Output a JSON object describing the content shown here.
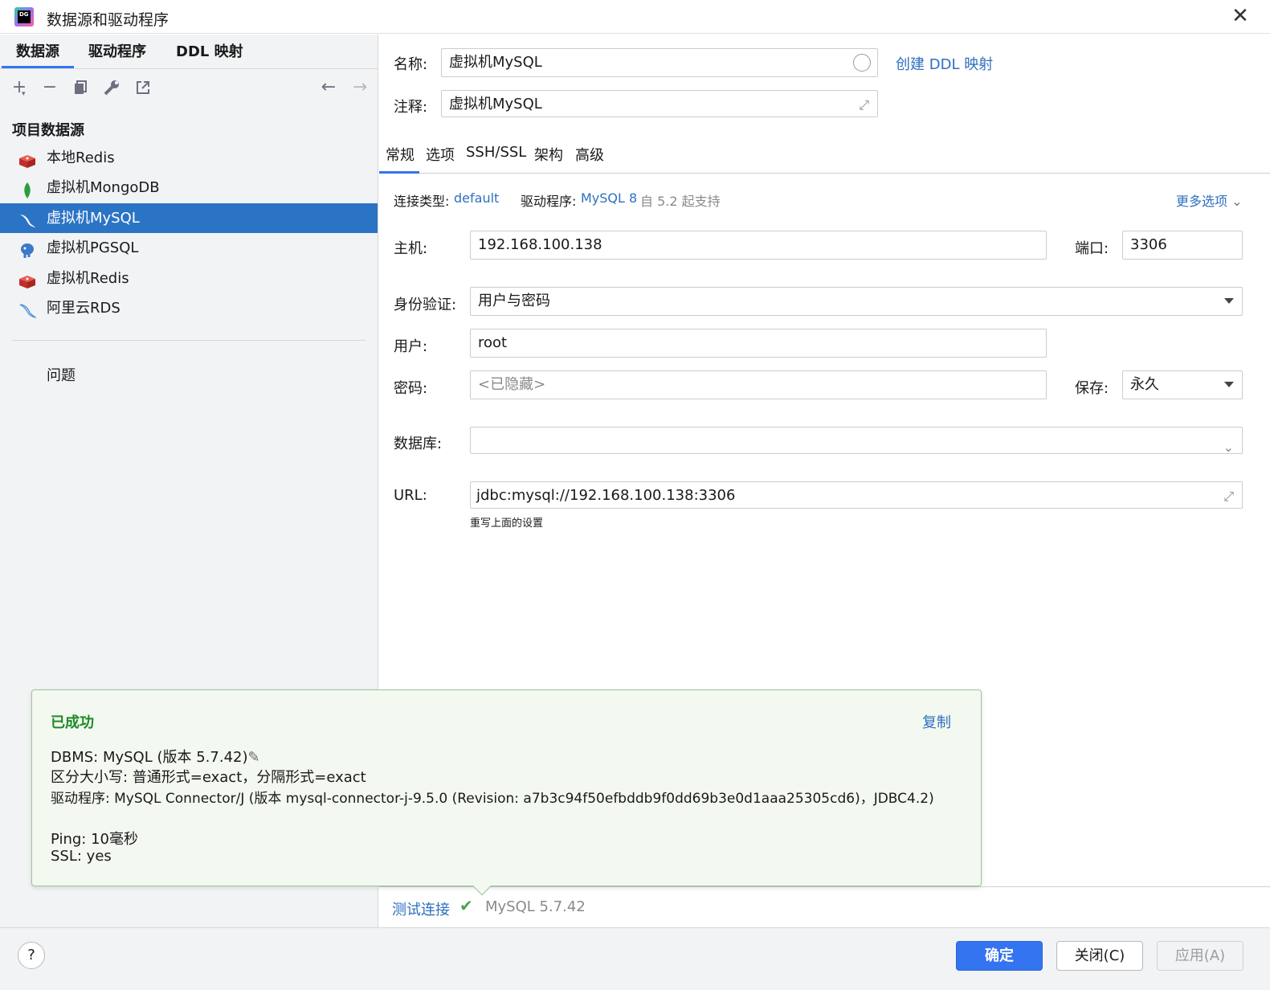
{
  "window": {
    "title": "数据源和驱动程序",
    "app_icon_text": "DG"
  },
  "left_tabs": [
    "数据源",
    "驱动程序",
    "DDL 映射"
  ],
  "section_title": "项目数据源",
  "datasources": [
    {
      "label": "本地Redis",
      "icon": "redis-icon",
      "selected": false
    },
    {
      "label": "虚拟机MongoDB",
      "icon": "mongodb-icon",
      "selected": false
    },
    {
      "label": "虚拟机MySQL",
      "icon": "mysql-icon",
      "selected": true
    },
    {
      "label": "虚拟机PGSQL",
      "icon": "postgresql-icon",
      "selected": false
    },
    {
      "label": "虚拟机Redis",
      "icon": "redis-icon",
      "selected": false
    },
    {
      "label": "阿里云RDS",
      "icon": "mysql-icon",
      "selected": false
    }
  ],
  "problems_label": "问题",
  "form": {
    "name_label": "名称:",
    "name_value": "虚拟机MySQL",
    "create_ddl_link": "创建 DDL 映射",
    "comment_label": "注释:",
    "comment_value": "虚拟机MySQL",
    "tabs": [
      "常规",
      "选项",
      "SSH/SSL",
      "架构",
      "高级"
    ],
    "conn_type_label": "连接类型:",
    "conn_type_value": "default",
    "driver_label": "驱动程序:",
    "driver_value": "MySQL 8",
    "driver_note": "自 5.2 起支持",
    "more_options": "更多选项",
    "host_label": "主机:",
    "host_value": "192.168.100.138",
    "port_label": "端口:",
    "port_value": "3306",
    "auth_label": "身份验证:",
    "auth_value": "用户与密码",
    "user_label": "用户:",
    "user_value": "root",
    "password_label": "密码:",
    "password_placeholder": "<已隐藏>",
    "save_label": "保存:",
    "save_value": "永久",
    "database_label": "数据库:",
    "database_value": "",
    "url_label": "URL:",
    "url_value": "jdbc:mysql://192.168.100.138:3306",
    "url_note": "重写上面的设置"
  },
  "popup": {
    "title": "已成功",
    "copy_link": "复制",
    "dbms_line": "DBMS: MySQL (版本 5.7.42)",
    "case_line": "区分大小写: 普通形式=exact，分隔形式=exact",
    "driver_line": "驱动程序: MySQL Connector/J (版本 mysql-connector-j-9.5.0 (Revision: a7b3c94f50efbddb9f0dd69b3e0d1aaa25305cd6)，JDBC4.2)",
    "ping_line": "Ping: 10毫秒",
    "ssl_line": "SSL: yes"
  },
  "test_connection": {
    "link": "测试连接",
    "version": "MySQL 5.7.42"
  },
  "footer": {
    "help": "?",
    "ok": "确定",
    "close": "关闭(C)",
    "apply": "应用(A)"
  },
  "colors": {
    "accent": "#3574f0",
    "selection": "#2b74c5",
    "success": "#1e8a28",
    "link": "#2f6fbf"
  }
}
